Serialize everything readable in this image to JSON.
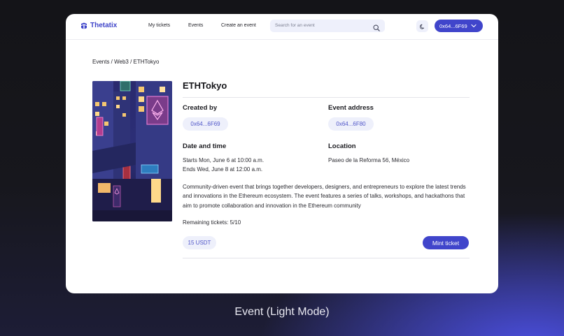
{
  "app": {
    "name": "Thetatix",
    "brand_color": "#3f45c9"
  },
  "nav": {
    "links": [
      "My tickets",
      "Events",
      "Create an event"
    ],
    "search_placeholder": "Search for an event",
    "theme_icon": "moon-icon",
    "wallet": {
      "address": "0x64...6F69",
      "icon": "chevron-down-icon"
    }
  },
  "breadcrumb": "Events / Web3 / ETHTokyo",
  "event": {
    "title": "ETHTokyo",
    "created_by_label": "Created by",
    "created_by": "0x64...6F69",
    "address_label": "Event address",
    "address": "0x64...6F80",
    "datetime_label": "Date and time",
    "starts": "Starts Mon, June 6 at 10:00 a.m.",
    "ends": "Ends Wed, June 8 at 12:00 a.m.",
    "location_label": "Location",
    "location": "Paseo de la Reforma 56, México",
    "description": "Community-driven event that brings together developers, designers, and entrepreneurs to explore the latest trends and innovations in the Ethereum ecosystem. The event features a series of talks, workshops, and hackathons that aim to promote collaboration and innovation in the Ethereum community",
    "remaining": "Remaining tickets: 5/10",
    "price": "15 USDT",
    "mint_label": "Mint ticket"
  },
  "caption": "Event (Light Mode)",
  "colors": {
    "accent": "#4045cb",
    "pill_bg": "#eef0fb"
  }
}
